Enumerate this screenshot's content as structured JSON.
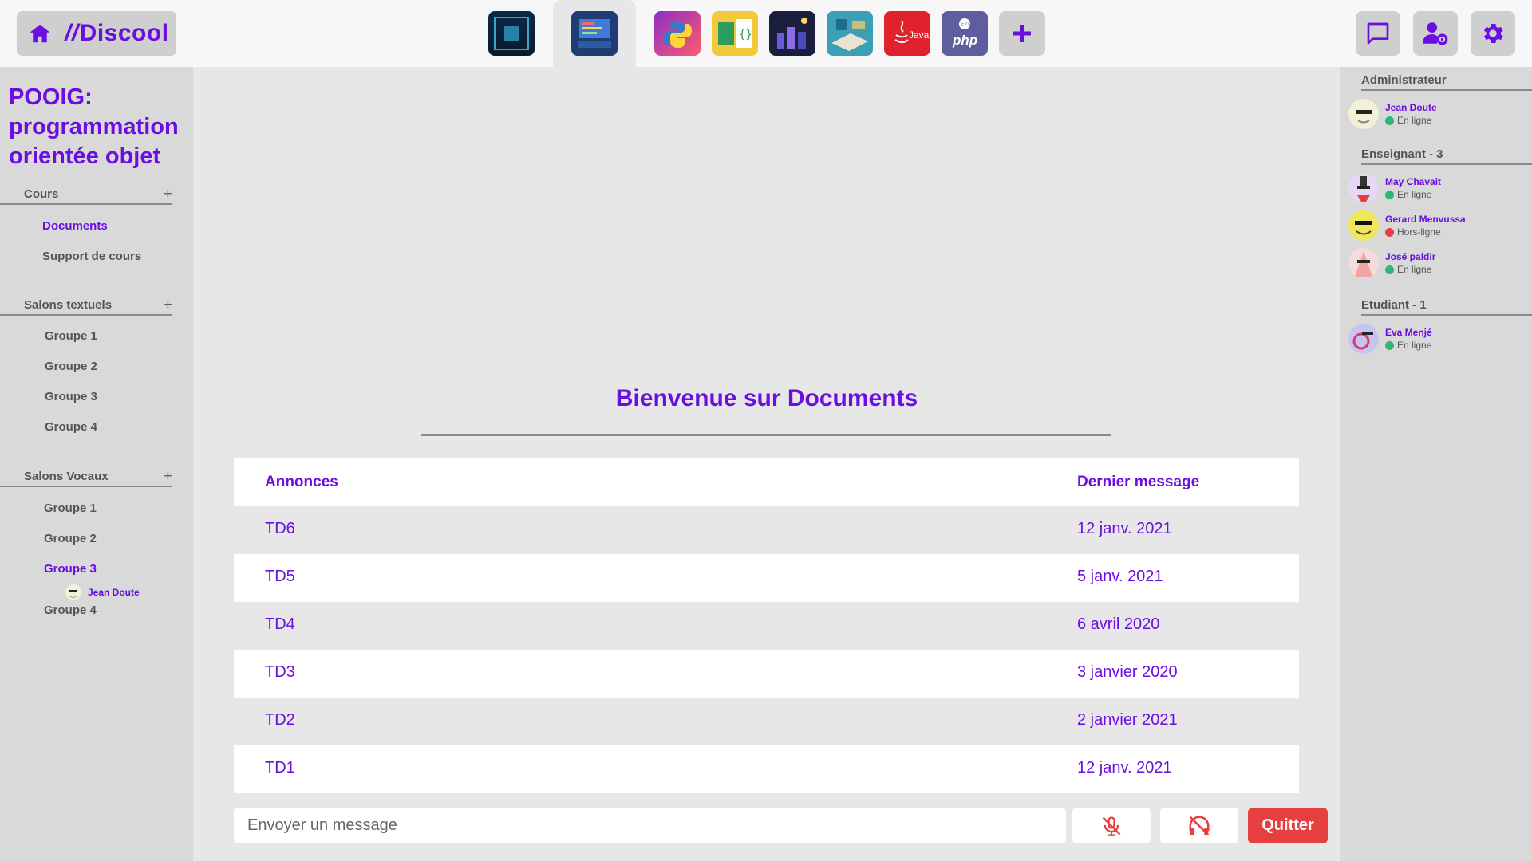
{
  "brand": {
    "name_slash": "//",
    "name_rest": "Discool"
  },
  "servers": [
    {
      "icon": "server-dark-corridor-icon"
    },
    {
      "icon": "server-code-screen-icon",
      "active": true
    },
    {
      "icon": "python-icon"
    },
    {
      "icon": "code-editor-icon"
    },
    {
      "icon": "server-night-city-icon"
    },
    {
      "icon": "server-blueprint-icon"
    },
    {
      "icon": "java-icon",
      "label": "Java"
    },
    {
      "icon": "php-icon",
      "label": "php"
    },
    {
      "icon": "add-server-icon"
    }
  ],
  "top_right": {
    "icons": [
      "chat-icon",
      "user-settings-icon",
      "gear-icon"
    ]
  },
  "course": {
    "title": "POOIG: programmation orientée objet"
  },
  "sidebar": {
    "sections": [
      {
        "label": "Cours",
        "plus": "+",
        "items": [
          "Documents",
          "Support de cours"
        ]
      },
      {
        "label": "Salons textuels",
        "plus": "+",
        "items": [
          "Groupe 1",
          "Groupe 2",
          "Groupe 3",
          "Groupe 4"
        ]
      },
      {
        "label": "Salons Vocaux",
        "plus": "+",
        "items": [
          "Groupe 1",
          "Groupe 2",
          "Groupe 3",
          "Groupe 4"
        ]
      }
    ],
    "active_item": "Documents",
    "voice_active_group": "Groupe 3",
    "voice_user": "Jean Doute"
  },
  "members": {
    "roles": [
      {
        "label": "Administrateur",
        "users": [
          {
            "name": "Jean Doute",
            "status": "En ligne",
            "online": true
          }
        ]
      },
      {
        "label": "Enseignant - 3",
        "users": [
          {
            "name": "May Chavait",
            "status": "En ligne",
            "online": true
          },
          {
            "name": "Gerard Menvussa",
            "status": "Hors-ligne",
            "online": false
          },
          {
            "name": "José paldir",
            "status": "En ligne",
            "online": true
          }
        ]
      },
      {
        "label": "Etudiant - 1",
        "users": [
          {
            "name": "Eva Menjé",
            "status": "En ligne",
            "online": true
          }
        ]
      }
    ]
  },
  "main": {
    "welcome": "Bienvenue sur Documents",
    "table": {
      "headers": [
        "Annonces",
        "Dernier message"
      ],
      "rows": [
        [
          "TD6",
          "12 janv. 2021"
        ],
        [
          "TD5",
          "5 janv. 2021"
        ],
        [
          "TD4",
          "6 avril 2020"
        ],
        [
          "TD3",
          "3 janvier 2020"
        ],
        [
          "TD2",
          "2 janvier 2021"
        ],
        [
          "TD1",
          "12 janv. 2021"
        ]
      ]
    },
    "composer": {
      "placeholder": "Envoyer un message"
    },
    "quit_label": "Quitter"
  },
  "colors": {
    "accent": "#6a0fe0",
    "danger": "#e53f3f",
    "online": "#2eb673"
  }
}
